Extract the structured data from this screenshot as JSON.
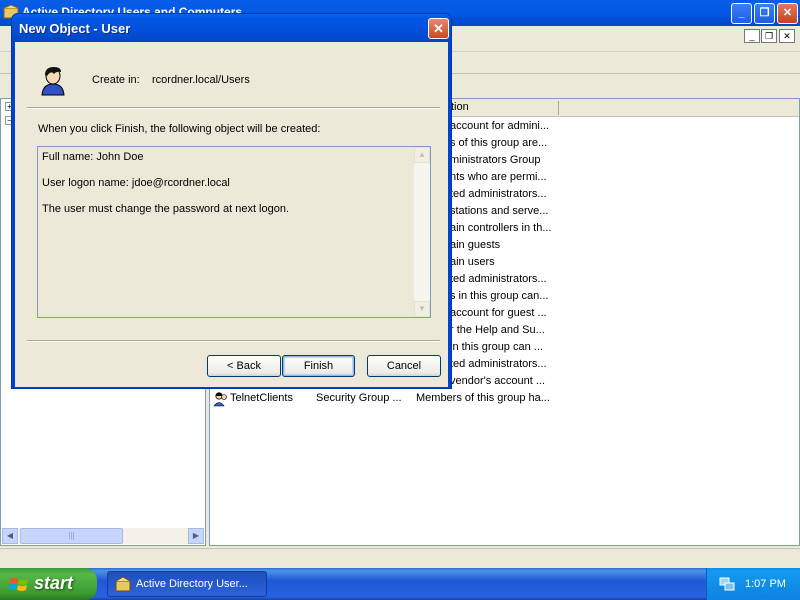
{
  "main_window": {
    "title": "Active Directory Users and Computers",
    "caption_buttons": {
      "minimize": "_",
      "maximize": "❐",
      "close": "✕"
    },
    "mdi_buttons": {
      "minimize": "_",
      "restore": "❐",
      "close": "✕"
    },
    "tree_expanders": [
      "+",
      "−"
    ]
  },
  "list": {
    "header_visible": "tion",
    "rows": [
      {
        "desc": "account for admini..."
      },
      {
        "desc": "s of this group are..."
      },
      {
        "desc": "ministrators Group"
      },
      {
        "desc": "nts who are permi..."
      },
      {
        "desc": "ted administrators..."
      },
      {
        "desc": "stations and serve..."
      },
      {
        "desc": "ain controllers in th..."
      },
      {
        "desc": "ain guests"
      },
      {
        "desc": "ain users"
      },
      {
        "desc": "ted administrators..."
      },
      {
        "desc": "s in this group can..."
      },
      {
        "desc": "account for guest ..."
      },
      {
        "desc": "r the Help and Su..."
      },
      {
        "desc": " in this group can ..."
      },
      {
        "desc": "ted administrators..."
      },
      {
        "desc": " vendor's account ..."
      }
    ],
    "last_row": {
      "name": "TelnetClients",
      "type": "Security Group ...",
      "desc": "Members of this group ha..."
    }
  },
  "dialog": {
    "title": "New Object - User",
    "close_glyph": "✕",
    "create_in_label": "Create in:",
    "create_in_path": "rcordner.local/Users",
    "intro": "When you click Finish, the following object will be created:",
    "summary_lines": [
      "Full name: John Doe",
      "User logon name: jdoe@rcordner.local",
      "The user must change the password at next logon."
    ],
    "buttons": {
      "back": "< Back",
      "finish": "Finish",
      "cancel": "Cancel"
    }
  },
  "taskbar": {
    "start_label": "start",
    "task_item": "Active Directory User...",
    "clock": "1:07 PM"
  },
  "icons": {
    "user": "user-icon",
    "windows_flag": "windows-flag-icon",
    "app": "ad-users-computers-icon",
    "tray": "network-icon"
  },
  "colors": {
    "titlebar_blue": "#0054e3",
    "start_green": "#3c9a3c",
    "close_red": "#c94a22",
    "dialog_face": "#ece9d8"
  }
}
